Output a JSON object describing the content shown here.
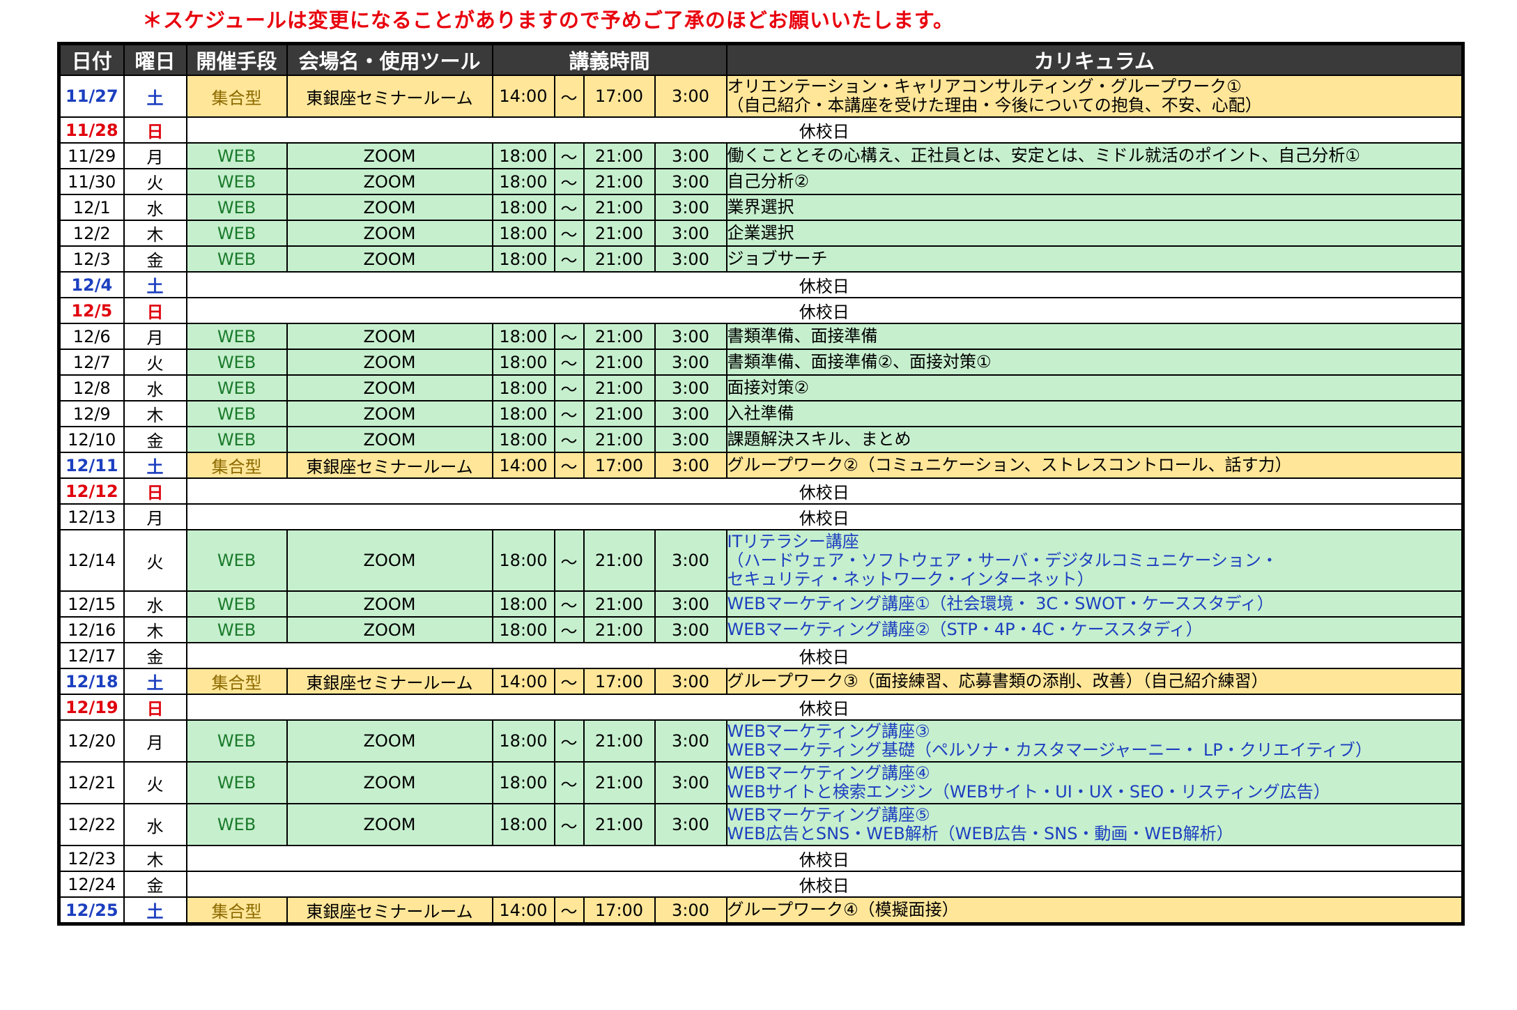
{
  "notice": "＊スケジュールは変更になることがありますので予めご了承のほどお願いいたします。",
  "headers": {
    "date": "日付",
    "day": "曜日",
    "mode": "開催手段",
    "venue": "会場名・使用ツール",
    "time": "講義時間",
    "curriculum": "カリキュラム"
  },
  "holiday_label": "休校日",
  "colors": {
    "web_bg": "#c6efce",
    "hall_bg": "#ffe699",
    "saturday": "#1c3fbf",
    "sunday": "#e0000d",
    "notice": "#e8000d",
    "header_bg": "#3a3a3a"
  },
  "rows": [
    {
      "date": "11/27",
      "day": "土",
      "dtype": "sat",
      "type": "hall",
      "mode": "集合型",
      "venue": "東銀座セミナールーム",
      "start": "14:00",
      "sep": "～",
      "end": "17:00",
      "dur": "3:00",
      "lines": [
        "オリエンテーション・キャリアコンサルティング・グループワーク①",
        "（自己紹介・本講座を受けた理由・今後についての抱負、不安、心配）"
      ],
      "blue": false
    },
    {
      "date": "11/28",
      "day": "日",
      "dtype": "sun",
      "type": "rest"
    },
    {
      "date": "11/29",
      "day": "月",
      "dtype": "wk",
      "type": "web",
      "mode": "WEB",
      "venue": "ZOOM",
      "start": "18:00",
      "sep": "～",
      "end": "21:00",
      "dur": "3:00",
      "lines": [
        "働くこととその心構え、正社員とは、安定とは、ミドル就活のポイント、自己分析①"
      ],
      "blue": false
    },
    {
      "date": "11/30",
      "day": "火",
      "dtype": "wk",
      "type": "web",
      "mode": "WEB",
      "venue": "ZOOM",
      "start": "18:00",
      "sep": "～",
      "end": "21:00",
      "dur": "3:00",
      "lines": [
        "自己分析②"
      ],
      "blue": false
    },
    {
      "date": "12/1",
      "day": "水",
      "dtype": "wk",
      "type": "web",
      "mode": "WEB",
      "venue": "ZOOM",
      "start": "18:00",
      "sep": "～",
      "end": "21:00",
      "dur": "3:00",
      "lines": [
        "業界選択"
      ],
      "blue": false
    },
    {
      "date": "12/2",
      "day": "木",
      "dtype": "wk",
      "type": "web",
      "mode": "WEB",
      "venue": "ZOOM",
      "start": "18:00",
      "sep": "～",
      "end": "21:00",
      "dur": "3:00",
      "lines": [
        "企業選択"
      ],
      "blue": false
    },
    {
      "date": "12/3",
      "day": "金",
      "dtype": "wk",
      "type": "web",
      "mode": "WEB",
      "venue": "ZOOM",
      "start": "18:00",
      "sep": "～",
      "end": "21:00",
      "dur": "3:00",
      "lines": [
        "ジョブサーチ"
      ],
      "blue": false
    },
    {
      "date": "12/4",
      "day": "土",
      "dtype": "sat",
      "type": "rest"
    },
    {
      "date": "12/5",
      "day": "日",
      "dtype": "sun",
      "type": "rest"
    },
    {
      "date": "12/6",
      "day": "月",
      "dtype": "wk",
      "type": "web",
      "mode": "WEB",
      "venue": "ZOOM",
      "start": "18:00",
      "sep": "～",
      "end": "21:00",
      "dur": "3:00",
      "lines": [
        "書類準備、面接準備"
      ],
      "blue": false
    },
    {
      "date": "12/7",
      "day": "火",
      "dtype": "wk",
      "type": "web",
      "mode": "WEB",
      "venue": "ZOOM",
      "start": "18:00",
      "sep": "～",
      "end": "21:00",
      "dur": "3:00",
      "lines": [
        "書類準備、面接準備②、面接対策①"
      ],
      "blue": false
    },
    {
      "date": "12/8",
      "day": "水",
      "dtype": "wk",
      "type": "web",
      "mode": "WEB",
      "venue": "ZOOM",
      "start": "18:00",
      "sep": "～",
      "end": "21:00",
      "dur": "3:00",
      "lines": [
        "面接対策②"
      ],
      "blue": false
    },
    {
      "date": "12/9",
      "day": "木",
      "dtype": "wk",
      "type": "web",
      "mode": "WEB",
      "venue": "ZOOM",
      "start": "18:00",
      "sep": "～",
      "end": "21:00",
      "dur": "3:00",
      "lines": [
        "入社準備"
      ],
      "blue": false
    },
    {
      "date": "12/10",
      "day": "金",
      "dtype": "wk",
      "type": "web",
      "mode": "WEB",
      "venue": "ZOOM",
      "start": "18:00",
      "sep": "～",
      "end": "21:00",
      "dur": "3:00",
      "lines": [
        "課題解決スキル、まとめ"
      ],
      "blue": false
    },
    {
      "date": "12/11",
      "day": "土",
      "dtype": "sat",
      "type": "hall",
      "mode": "集合型",
      "venue": "東銀座セミナールーム",
      "start": "14:00",
      "sep": "～",
      "end": "17:00",
      "dur": "3:00",
      "lines": [
        "グループワーク②（コミュニケーション、ストレスコントロール、話す力）"
      ],
      "blue": false
    },
    {
      "date": "12/12",
      "day": "日",
      "dtype": "sun",
      "type": "rest"
    },
    {
      "date": "12/13",
      "day": "月",
      "dtype": "wk",
      "type": "rest"
    },
    {
      "date": "12/14",
      "day": "火",
      "dtype": "wk",
      "type": "web",
      "mode": "WEB",
      "venue": "ZOOM",
      "start": "18:00",
      "sep": "～",
      "end": "21:00",
      "dur": "3:00",
      "lines": [
        "ITリテラシー講座",
        "（ハードウェア・ソフトウェア・サーバ・デジタルコミュニケーション・",
        "セキュリティ・ネットワーク・インターネット）"
      ],
      "blue": true
    },
    {
      "date": "12/15",
      "day": "水",
      "dtype": "wk",
      "type": "web",
      "mode": "WEB",
      "venue": "ZOOM",
      "start": "18:00",
      "sep": "～",
      "end": "21:00",
      "dur": "3:00",
      "lines": [
        "WEBマーケティング講座①（社会環境・ 3C・SWOT・ケーススタディ）"
      ],
      "blue": true
    },
    {
      "date": "12/16",
      "day": "木",
      "dtype": "wk",
      "type": "web",
      "mode": "WEB",
      "venue": "ZOOM",
      "start": "18:00",
      "sep": "～",
      "end": "21:00",
      "dur": "3:00",
      "lines": [
        "WEBマーケティング講座②（STP・4P・4C・ケーススタディ）"
      ],
      "blue": true
    },
    {
      "date": "12/17",
      "day": "金",
      "dtype": "wk",
      "type": "rest"
    },
    {
      "date": "12/18",
      "day": "土",
      "dtype": "sat",
      "type": "hall",
      "mode": "集合型",
      "venue": "東銀座セミナールーム",
      "start": "14:00",
      "sep": "～",
      "end": "17:00",
      "dur": "3:00",
      "lines": [
        "グループワーク③（面接練習、応募書類の添削、改善）（自己紹介練習）"
      ],
      "blue": false
    },
    {
      "date": "12/19",
      "day": "日",
      "dtype": "sun",
      "type": "rest"
    },
    {
      "date": "12/20",
      "day": "月",
      "dtype": "wk",
      "type": "web",
      "mode": "WEB",
      "venue": "ZOOM",
      "start": "18:00",
      "sep": "～",
      "end": "21:00",
      "dur": "3:00",
      "lines": [
        "WEBマーケティング講座③",
        "WEBマーケティング基礎（ペルソナ・カスタマージャーニー・ LP・クリエイティブ）"
      ],
      "blue": true
    },
    {
      "date": "12/21",
      "day": "火",
      "dtype": "wk",
      "type": "web",
      "mode": "WEB",
      "venue": "ZOOM",
      "start": "18:00",
      "sep": "～",
      "end": "21:00",
      "dur": "3:00",
      "lines": [
        "WEBマーケティング講座④",
        "WEBサイトと検索エンジン（WEBサイト・UI・UX・SEO・リスティング広告）"
      ],
      "blue": true
    },
    {
      "date": "12/22",
      "day": "水",
      "dtype": "wk",
      "type": "web",
      "mode": "WEB",
      "venue": "ZOOM",
      "start": "18:00",
      "sep": "～",
      "end": "21:00",
      "dur": "3:00",
      "lines": [
        "WEBマーケティング講座⑤",
        "WEB広告とSNS・WEB解析（WEB広告・SNS・動画・WEB解析）"
      ],
      "blue": true
    },
    {
      "date": "12/23",
      "day": "木",
      "dtype": "wk",
      "type": "rest"
    },
    {
      "date": "12/24",
      "day": "金",
      "dtype": "wk",
      "type": "rest"
    },
    {
      "date": "12/25",
      "day": "土",
      "dtype": "sat",
      "type": "hall",
      "mode": "集合型",
      "venue": "東銀座セミナールーム",
      "start": "14:00",
      "sep": "～",
      "end": "17:00",
      "dur": "3:00",
      "lines": [
        "グループワーク④（模擬面接）"
      ],
      "blue": false
    }
  ]
}
